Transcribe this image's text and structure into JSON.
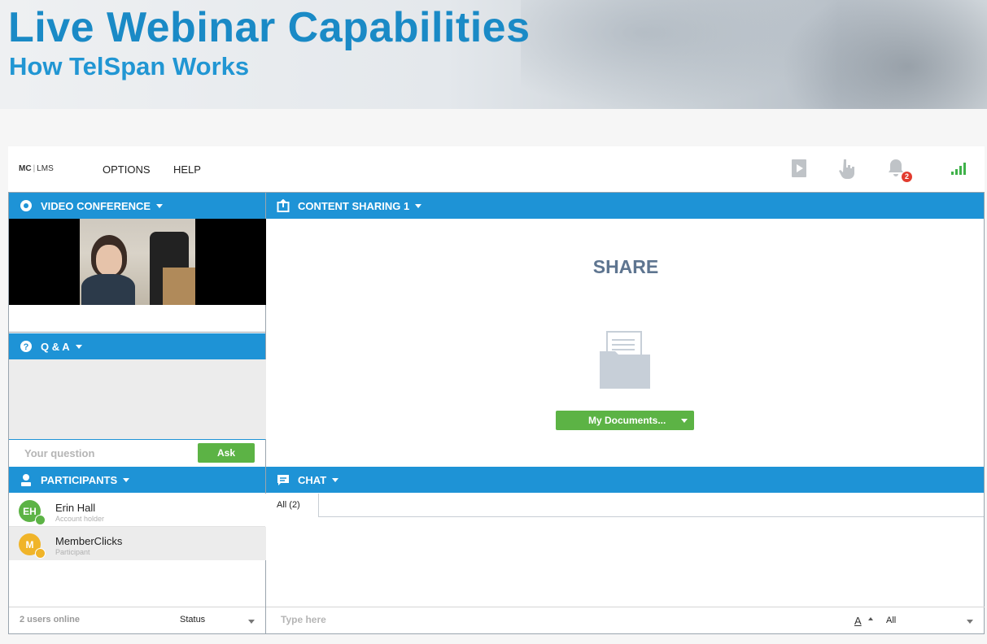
{
  "banner": {
    "title": "Live Webinar Capabilities",
    "subtitle": "How TelSpan Works"
  },
  "app": {
    "logo_main": "MC",
    "logo_sub": "LMS",
    "menu": [
      "OPTIONS",
      "HELP"
    ],
    "toolbar_icons": [
      "play-media-icon",
      "raise-hand-icon",
      "notifications-icon",
      "signal-strength-icon"
    ],
    "notification_count": "2",
    "accent_color": "#1e93d6",
    "button_color": "#5cb345"
  },
  "video_panel": {
    "title": "VIDEO CONFERENCE"
  },
  "qa_panel": {
    "title": "Q & A",
    "input_placeholder": "Your question",
    "ask_label": "Ask"
  },
  "content_panel": {
    "title": "CONTENT SHARING 1",
    "share_heading": "SHARE",
    "documents_button": "My Documents..."
  },
  "participants_panel": {
    "title": "PARTICIPANTS",
    "participants": [
      {
        "initials": "EH",
        "name": "Erin Hall",
        "role": "Account holder",
        "color": "#5cb345"
      },
      {
        "initials": "M",
        "name": "MemberClicks",
        "role": "Participant",
        "color": "#f0b429"
      }
    ],
    "users_online": "2 users online",
    "status_label": "Status"
  },
  "chat_panel": {
    "title": "CHAT",
    "tab_label": "All (2)",
    "input_placeholder": "Type here",
    "recipient": "All",
    "font_icon_label": "A"
  }
}
